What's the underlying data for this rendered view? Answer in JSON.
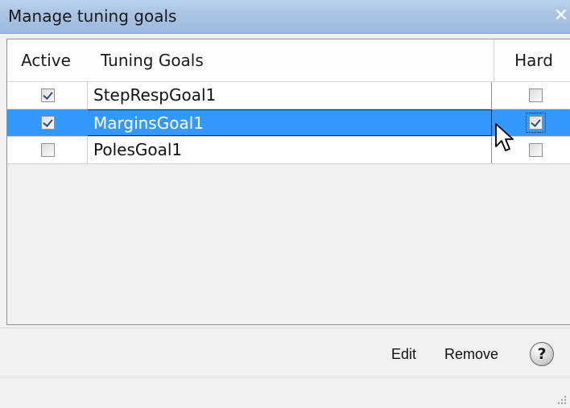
{
  "window": {
    "title": "Manage tuning goals",
    "close_glyph": "✕"
  },
  "table": {
    "columns": [
      "Active",
      "Tuning Goals",
      "Hard"
    ],
    "rows": [
      {
        "active": true,
        "name": "StepRespGoal1",
        "hard": false,
        "selected": false
      },
      {
        "active": true,
        "name": "MarginsGoal1",
        "hard": true,
        "selected": true
      },
      {
        "active": false,
        "name": "PolesGoal1",
        "hard": false,
        "selected": false
      }
    ]
  },
  "footer": {
    "edit_label": "Edit",
    "remove_label": "Remove",
    "help_glyph": "?"
  },
  "colors": {
    "selection": "#3399ff",
    "titlebar": "#a9c3e2"
  },
  "icons": {
    "close": "close-icon",
    "help": "help-icon",
    "cursor": "mouse-pointer-icon",
    "grip": "resize-grip-icon"
  }
}
